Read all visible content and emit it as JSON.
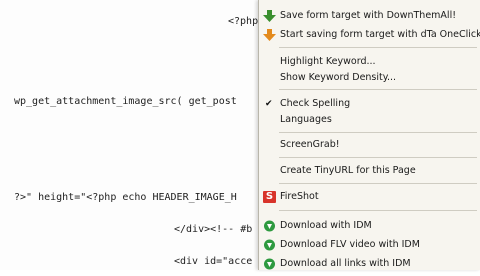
{
  "editor": {
    "lines": [
      "<?php",
      "wp_get_attachment_image_src( get_post",
      "?>\" height=\"<?php echo HEADER_IMAGE_H",
      "</div><!-- #b",
      "<div id=\"acce"
    ]
  },
  "menu": {
    "items": [
      {
        "label": "Save form target with DownThemAll!",
        "icon": "downthemall-icon"
      },
      {
        "label": "Start saving form target with dTa OneClick!",
        "icon": "dta-oneclick-icon"
      },
      {
        "label": "Highlight Keyword..."
      },
      {
        "label": "Show Keyword Density..."
      },
      {
        "label": "Check Spelling",
        "checked": true
      },
      {
        "label": "Languages"
      },
      {
        "label": "ScreenGrab!"
      },
      {
        "label": "Create TinyURL for this Page"
      },
      {
        "label": "FireShot",
        "icon": "fireshot-icon"
      },
      {
        "label": "Download with IDM",
        "icon": "idm-icon"
      },
      {
        "label": "Download FLV video with IDM",
        "icon": "idm-icon"
      },
      {
        "label": "Download all links with IDM",
        "icon": "idm-icon"
      }
    ],
    "fireshot_glyph": "S",
    "check_glyph": "✔"
  },
  "colors": {
    "downthemall_green": "#3a8f2e",
    "oneclick_orange": "#e38a1c",
    "fireshot_red": "#d8332a",
    "idm_green": "#2e9a3f"
  }
}
